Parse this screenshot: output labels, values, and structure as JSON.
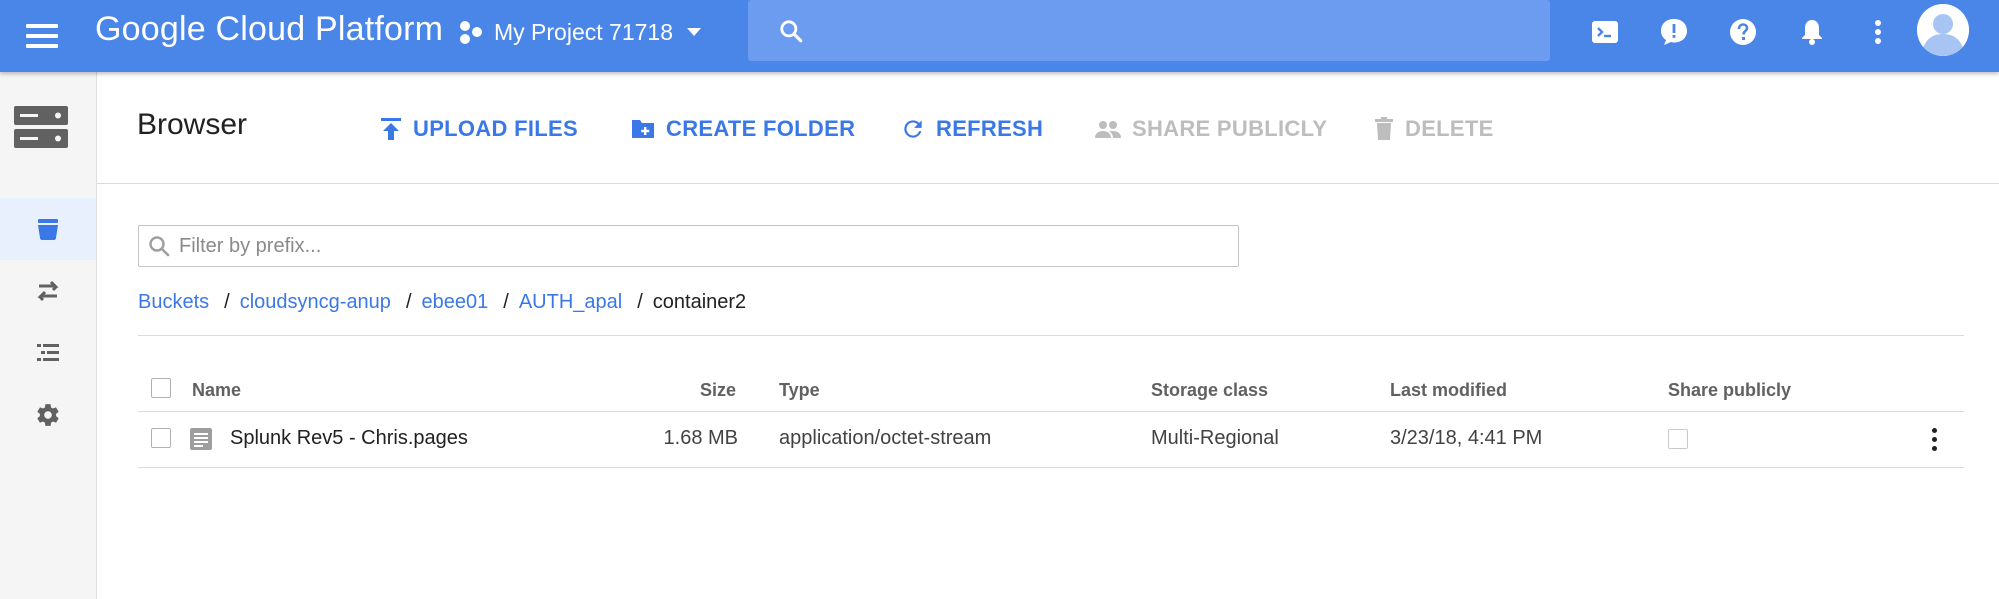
{
  "header": {
    "brand": "Google Cloud Platform",
    "project": "My Project 71718",
    "search_placeholder": "",
    "icons": [
      "menu-icon",
      "project-icon",
      "search-icon",
      "cloud-shell-icon",
      "feedback-icon",
      "help-icon",
      "notifications-icon",
      "more-vert-icon",
      "avatar"
    ]
  },
  "rail": {
    "items": [
      {
        "name": "storage-product-icon"
      },
      {
        "name": "bucket-icon",
        "active": true
      },
      {
        "name": "transfer-icon"
      },
      {
        "name": "transfer-appliance-icon"
      },
      {
        "name": "settings-icon"
      }
    ]
  },
  "toolbar": {
    "title": "Browser",
    "upload": "UPLOAD FILES",
    "create_folder": "CREATE FOLDER",
    "refresh": "REFRESH",
    "share": "SHARE PUBLICLY",
    "delete": "DELETE"
  },
  "filter": {
    "placeholder": "Filter by prefix..."
  },
  "breadcrumb": {
    "items": [
      "Buckets",
      "cloudsyncg-anup",
      "ebee01",
      "AUTH_apal"
    ],
    "current": "container2",
    "separator": "/"
  },
  "table": {
    "columns": {
      "name": "Name",
      "size": "Size",
      "type": "Type",
      "storage_class": "Storage class",
      "last_modified": "Last modified",
      "share_publicly": "Share publicly"
    },
    "rows": [
      {
        "name": "Splunk Rev5 - Chris.pages",
        "size": "1.68 MB",
        "type": "application/octet-stream",
        "storage_class": "Multi-Regional",
        "last_modified": "3/23/18, 4:41 PM",
        "shared": false
      }
    ]
  },
  "colors": {
    "topbar": "#4a85e8",
    "link": "#3b78e7",
    "disabled": "#bdbdbd"
  }
}
